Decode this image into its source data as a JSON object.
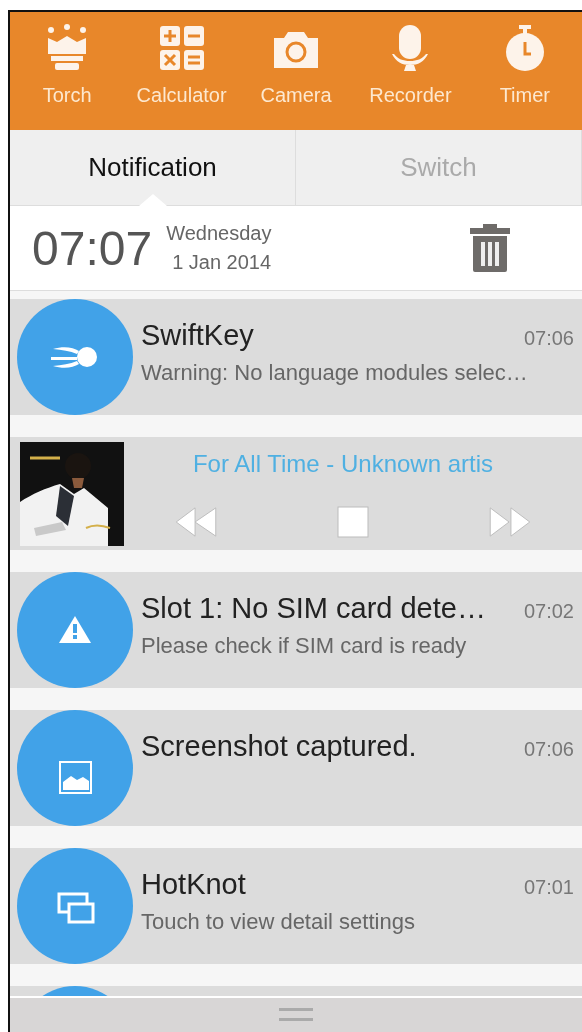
{
  "tools": [
    {
      "kind": "torch",
      "label": "Torch"
    },
    {
      "kind": "calculator",
      "label": "Calculator"
    },
    {
      "kind": "camera",
      "label": "Camera"
    },
    {
      "kind": "recorder",
      "label": "Recorder"
    },
    {
      "kind": "timer",
      "label": "Timer"
    }
  ],
  "tabs": [
    {
      "label": "Notification",
      "selected": true
    },
    {
      "label": "Switch",
      "selected": false
    }
  ],
  "clock": {
    "time": "07:07",
    "day": "Wednesday",
    "date": "1 Jan 2014"
  },
  "notifications": [
    {
      "kind": "app",
      "title": "SwiftKey",
      "time": "07:06",
      "text": "Warning: No language modules selec…"
    },
    {
      "kind": "media",
      "title": "For All Time - Unknown artis"
    },
    {
      "kind": "app",
      "title": "Slot 1: No SIM card dete…",
      "time": "07:02",
      "text": "Please check if SIM card is ready"
    },
    {
      "kind": "app",
      "title": "Screenshot captured.",
      "time": "07:06"
    },
    {
      "kind": "app",
      "title": "HotKnot",
      "time": "07:01",
      "text": "Touch to view detail settings"
    },
    {
      "kind": "partial"
    }
  ]
}
